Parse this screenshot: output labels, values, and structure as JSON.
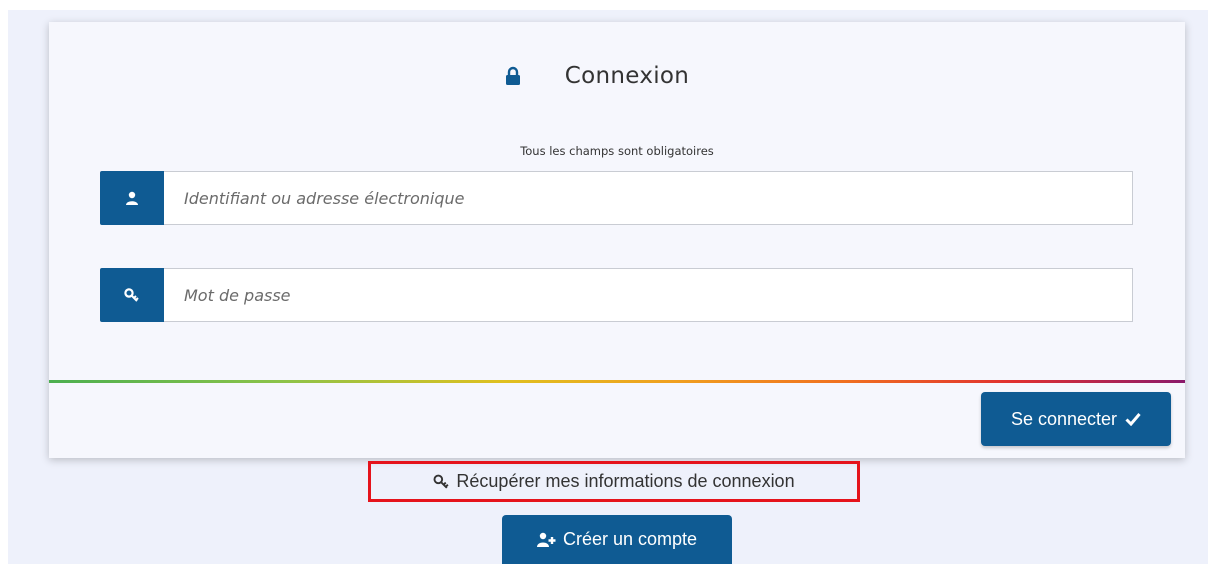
{
  "login": {
    "title": "Connexion",
    "required_note": "Tous les champs sont obligatoires",
    "username_field": {
      "placeholder": "Identifiant ou adresse électronique",
      "value": ""
    },
    "password_field": {
      "placeholder": "Mot de passe",
      "value": ""
    },
    "submit_label": "Se connecter",
    "recover_link": "Récupérer mes informations de connexion",
    "create_account_label": "Créer un compte"
  },
  "colors": {
    "primary": "#0f5b93",
    "highlight_border": "#e5131b",
    "page_background": "#eef1fb"
  },
  "icons": {
    "title": "lock-icon",
    "username": "user-icon",
    "password": "key-icon",
    "submit": "check-icon",
    "recover": "key-icon",
    "create": "user-plus-icon"
  }
}
